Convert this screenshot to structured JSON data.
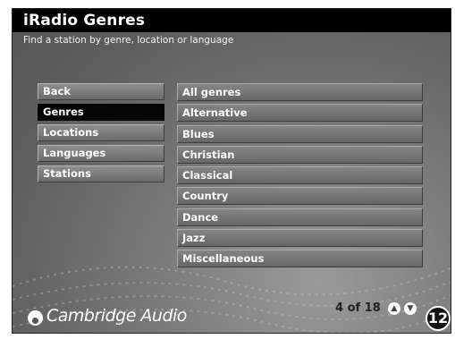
{
  "header": {
    "title": "iRadio Genres",
    "subtitle": "Find a station by genre, location or language"
  },
  "nav": {
    "items": [
      {
        "label": "Back"
      },
      {
        "label": "Genres"
      },
      {
        "label": "Locations"
      },
      {
        "label": "Languages"
      },
      {
        "label": "Stations"
      }
    ],
    "selected": "Genres"
  },
  "genres": {
    "items": [
      {
        "label": "All genres"
      },
      {
        "label": "Alternative"
      },
      {
        "label": "Blues"
      },
      {
        "label": "Christian"
      },
      {
        "label": "Classical"
      },
      {
        "label": "Country"
      },
      {
        "label": "Dance"
      },
      {
        "label": "Jazz"
      },
      {
        "label": "Miscellaneous"
      }
    ]
  },
  "footer": {
    "brand": "Cambridge Audio",
    "pager": "4 of 18",
    "badge": "12"
  },
  "icons": {
    "up": "arrow-up-icon",
    "down": "arrow-down-icon",
    "brand_logo": "cambridge-audio-logo-icon"
  }
}
